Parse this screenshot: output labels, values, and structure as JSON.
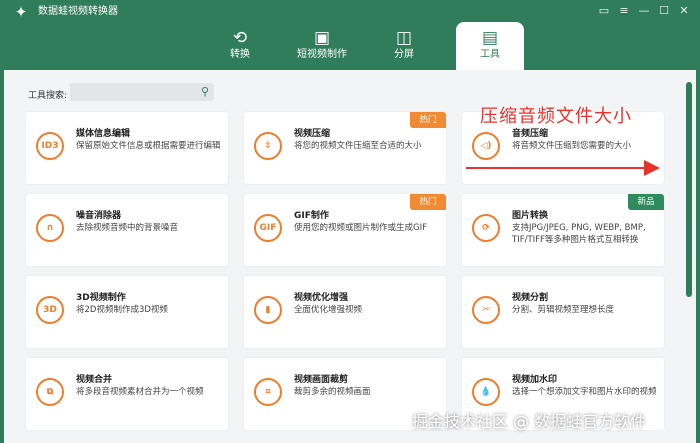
{
  "app": {
    "title": "数据蛙视频转换器",
    "logo_icon": "frog-logo-icon"
  },
  "window_controls": [
    {
      "name": "feedback-icon",
      "glyph": "▭"
    },
    {
      "name": "menu-icon",
      "glyph": "≡"
    },
    {
      "name": "minimize-icon",
      "glyph": "—"
    },
    {
      "name": "maximize-icon",
      "glyph": "☐"
    },
    {
      "name": "close-icon",
      "glyph": "✕"
    }
  ],
  "tabs": [
    {
      "label": "转换",
      "icon": "convert-icon",
      "glyph": "⟲"
    },
    {
      "label": "短视频制作",
      "icon": "image-icon",
      "glyph": "▣"
    },
    {
      "label": "分屏",
      "icon": "split-screen-icon",
      "glyph": "◫"
    },
    {
      "label": "工具",
      "icon": "toolbox-icon",
      "glyph": "▤",
      "active": true
    }
  ],
  "search": {
    "label": "工具搜索:",
    "placeholder": ""
  },
  "cards": [
    {
      "title": "媒体信息编辑",
      "desc": "保留原始文件信息或根据需要进行编辑",
      "icon": "id3-icon",
      "glyph": "ID3"
    },
    {
      "title": "视频压缩",
      "desc": "将您的视频文件压缩至合适的大小",
      "icon": "compress-icon",
      "glyph": "⇳",
      "badge": "热门"
    },
    {
      "title": "音频压缩",
      "desc": "将音频文件压缩到您需要的大小",
      "icon": "audio-compress-icon",
      "glyph": "◁)"
    },
    {
      "title": "噪音消除器",
      "desc": "去除视频音频中的背景噪音",
      "icon": "headphone-icon",
      "glyph": "∩"
    },
    {
      "title": "GIF制作",
      "desc": "使用您的视频或图片制作或生成GIF",
      "icon": "gif-icon",
      "glyph": "GIF",
      "badge": "热门"
    },
    {
      "title": "图片转换",
      "desc": "支持JPG/JPEG, PNG, WEBP, BMP, TIF/TIFF等多种图片格式互相转换",
      "icon": "image-convert-icon",
      "glyph": "⟳",
      "badge_new": "新品"
    },
    {
      "title": "3D视频制作",
      "desc": "将2D视频制作成3D视频",
      "icon": "3d-icon",
      "glyph": "3D"
    },
    {
      "title": "视频优化增强",
      "desc": "全面优化增强视频",
      "icon": "enhance-icon",
      "glyph": "▮"
    },
    {
      "title": "视频分割",
      "desc": "分割、剪辑视频至理想长度",
      "icon": "scissors-icon",
      "glyph": "✂"
    },
    {
      "title": "视频合并",
      "desc": "将多段音视频素材合并为一个视频",
      "icon": "merge-icon",
      "glyph": "⧉"
    },
    {
      "title": "视频画面裁剪",
      "desc": "裁剪多余的视频画面",
      "icon": "crop-icon",
      "glyph": "⌗"
    },
    {
      "title": "视频加水印",
      "desc": "选择一个想添加文字和图片水印的视频",
      "icon": "watermark-icon",
      "glyph": "💧"
    }
  ],
  "annotation": {
    "text": "压缩音频文件大小"
  },
  "watermark": {
    "text": "掘金技术社区 @ 数据蛙官方软件"
  },
  "colors": {
    "brand_green": "#2f7d5b",
    "accent_orange": "#f07c2c",
    "annotation_red": "#e8322c"
  }
}
